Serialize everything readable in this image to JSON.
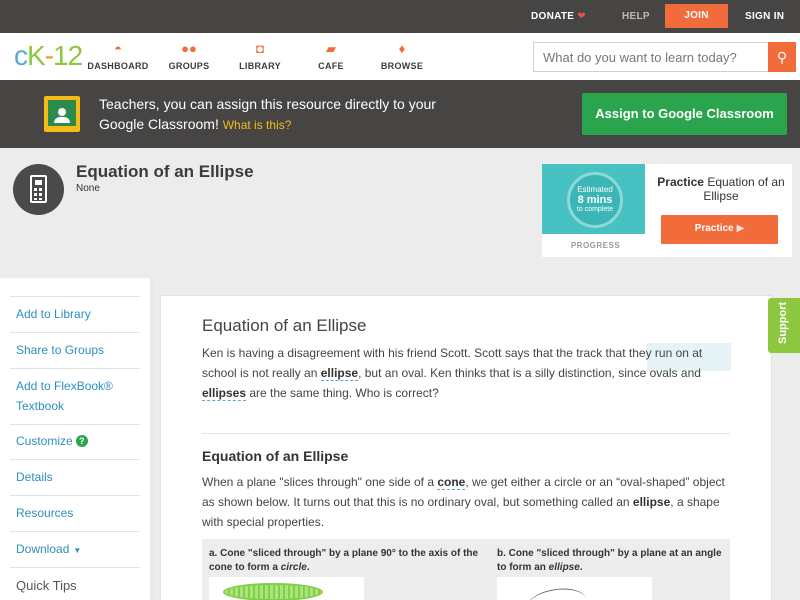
{
  "topbar": {
    "donate": "DONATE",
    "help": "HELP",
    "join": "JOIN",
    "signin": "SIGN IN"
  },
  "nav": {
    "logo": {
      "c": "c",
      "k": "K",
      "dash": "-",
      "num": "12"
    },
    "items": [
      {
        "label": "DASHBOARD",
        "icon": "dashboard-icon"
      },
      {
        "label": "GROUPS",
        "icon": "groups-icon"
      },
      {
        "label": "LIBRARY",
        "icon": "library-icon"
      },
      {
        "label": "CAFE",
        "icon": "cafe-icon"
      },
      {
        "label": "BROWSE",
        "icon": "browse-icon"
      }
    ],
    "search_placeholder": "What do you want to learn today?"
  },
  "classroom": {
    "text": "Teachers, you can assign this resource directly to your Google Classroom!",
    "what": "What is this?",
    "button": "Assign to Google Classroom"
  },
  "page": {
    "title": "Equation of an Ellipse",
    "subtitle": "None"
  },
  "practice": {
    "estimated": "Estimated",
    "mins": "8 mins",
    "to_complete": "to complete",
    "progress_label": "PROGRESS",
    "practice_bold": "Practice",
    "practice_rest": "Equation of an Ellipse",
    "button": "Practice"
  },
  "sidebar": {
    "items": [
      "Add to Library",
      "Share to Groups",
      "Add to FlexBook® Textbook",
      "Customize",
      "Details",
      "Resources",
      "Download"
    ],
    "quick_tips": "Quick Tips",
    "customize_help": "?"
  },
  "content": {
    "heading": "Equation of an Ellipse",
    "intro_1": "Ken is having a disagreement with his friend Scott. Scott says that the track that they run on at school is not really an ",
    "intro_kw1": "ellipse",
    "intro_2": ", but an oval. Ken thinks that is a silly distinction, since ovals and ",
    "intro_kw2": "ellipses",
    "intro_3": " are the same thing. Who is correct?",
    "section_heading": "Equation of an Ellipse",
    "body_1": "When a plane \"slices through\" one side of a ",
    "body_kw1": "cone",
    "body_2": ", we get either a circle or an “oval-shaped” object as shown below. It turns out that this is no ordinary oval, but something called an ",
    "body_kw2": "ellipse",
    "body_3": ", a shape with special properties.",
    "fig_a_1": "a. Cone \"sliced through\" by a plane 90° to the axis of the cone to form a ",
    "fig_a_2": "circle",
    "fig_a_3": ".",
    "fig_b_1": "b. Cone \"sliced through\" by a plane at an angle to form an ",
    "fig_b_2": "ellipse",
    "fig_b_3": "."
  },
  "support": "Support",
  "colors": {
    "accent": "#f26b3a",
    "link": "#2e8fbf",
    "green": "#2aa54e",
    "dark_bar": "#474543"
  }
}
